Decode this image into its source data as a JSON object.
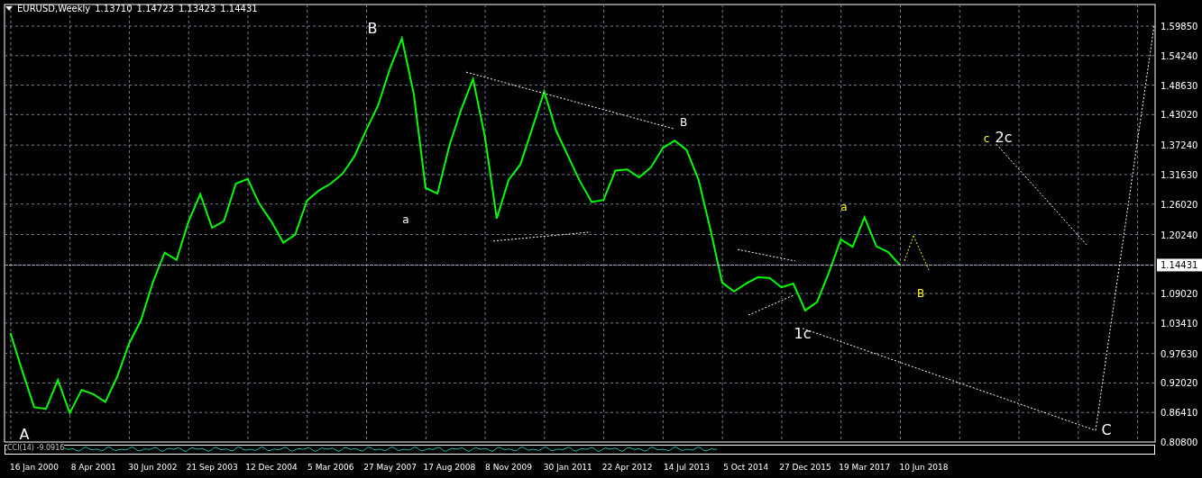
{
  "header": {
    "symbol": "EURUSD,Weekly",
    "prices": [
      "1.13710",
      "1.14723",
      "1.13423",
      "1.14431"
    ]
  },
  "indicator": {
    "label": "CCI(14) -9.0916"
  },
  "chart": {
    "current_price": "1.14431",
    "wave_labels": [
      {
        "text": "A",
        "color": "#ffffff"
      },
      {
        "text": "B",
        "color": "#ffffff"
      },
      {
        "text": "a",
        "color": "#ffffff"
      },
      {
        "text": "B",
        "color": "#ffffff"
      },
      {
        "text": "a",
        "color": "#ffff00"
      },
      {
        "text": "1c",
        "color": "#ffffff"
      },
      {
        "text": "B",
        "color": "#ffff00"
      },
      {
        "text": "c",
        "color": "#ffff00"
      },
      {
        "text": "2c",
        "color": "#ffffff"
      },
      {
        "text": "C",
        "color": "#ffffff"
      }
    ],
    "chart_data": {
      "type": "line",
      "ylim": [
        0.808,
        1.6396
      ],
      "grid": true,
      "categories": [
        null,
        null,
        "16 Jan 2000",
        null,
        null,
        null,
        null,
        "8 Apr 2001",
        null,
        null,
        null,
        null,
        "30 Jun 2002",
        null,
        null,
        null,
        null,
        "21 Sep 2003",
        null,
        null,
        null,
        null,
        "12 Dec 2004",
        null,
        null,
        null,
        null,
        "5 Mar 2006",
        null,
        null,
        null,
        null,
        "27 May 2007",
        null,
        null,
        null,
        null,
        "17 Aug 2008",
        null,
        null,
        null,
        null,
        "8 Nov 2009",
        null,
        null,
        null,
        null,
        "30 Jan 2011",
        null,
        null,
        null,
        null,
        "22 Apr 2012",
        null,
        null,
        null,
        null,
        "14 Jul 2013",
        null,
        null,
        null,
        null,
        "5 Oct 2014",
        null,
        null,
        null,
        null,
        "27 Dec 2015",
        null,
        null,
        null,
        null,
        "19 Mar 2017",
        null,
        null,
        null,
        null,
        "10 Jun 2018",
        null,
        null,
        null,
        null,
        null,
        null,
        null,
        null,
        null,
        null,
        null,
        null,
        null,
        null,
        null,
        null,
        null,
        null,
        null
      ],
      "yticks": [
        {
          "value": 1.5985,
          "label": "1.59850"
        },
        {
          "value": 1.5424,
          "label": "1.54240"
        },
        {
          "value": 1.4863,
          "label": "1.48630"
        },
        {
          "value": 1.4302,
          "label": "1.43020"
        },
        {
          "value": 1.3724,
          "label": "1.37240"
        },
        {
          "value": 1.3163,
          "label": "1.31630"
        },
        {
          "value": 1.2602,
          "label": "1.26020"
        },
        {
          "value": 1.2024,
          "label": "1.20240"
        },
        {
          "value": 1.0902,
          "label": "1.09020"
        },
        {
          "value": 1.0341,
          "label": "1.03410"
        },
        {
          "value": 0.9763,
          "label": "0.97630"
        },
        {
          "value": 0.9202,
          "label": "0.92020"
        },
        {
          "value": 0.8641,
          "label": "0.86410"
        },
        {
          "value": 0.808,
          "label": "0.80800"
        }
      ],
      "series": [
        {
          "color": "#00ff00",
          "values": [
            1.015,
            0.943,
            0.874,
            0.871,
            0.926,
            0.863,
            0.907,
            0.899,
            0.884,
            0.932,
            0.995,
            1.039,
            1.111,
            1.168,
            1.154,
            1.226,
            1.279,
            1.215,
            1.228,
            1.299,
            1.308,
            1.26,
            1.227,
            1.187,
            1.202,
            1.267,
            1.286,
            1.299,
            1.318,
            1.351,
            1.401,
            1.448,
            1.518,
            1.575,
            1.47,
            1.291,
            1.28,
            1.371,
            1.44,
            1.498,
            1.388,
            1.233,
            1.306,
            1.336,
            1.405,
            1.474,
            1.4,
            1.352,
            1.304,
            1.264,
            1.268,
            1.324,
            1.326,
            1.311,
            1.33,
            1.367,
            1.381,
            1.363,
            1.307,
            1.213,
            1.111,
            1.094,
            1.109,
            1.121,
            1.12,
            1.102,
            1.109,
            1.058,
            1.074,
            1.13,
            1.193,
            1.179,
            1.235,
            1.18,
            1.169,
            1.144,
            null,
            null,
            null,
            null,
            null,
            null,
            null,
            null,
            null,
            null,
            null,
            null,
            null,
            null,
            null,
            null,
            null,
            null,
            null,
            null,
            null
          ]
        }
      ]
    }
  }
}
